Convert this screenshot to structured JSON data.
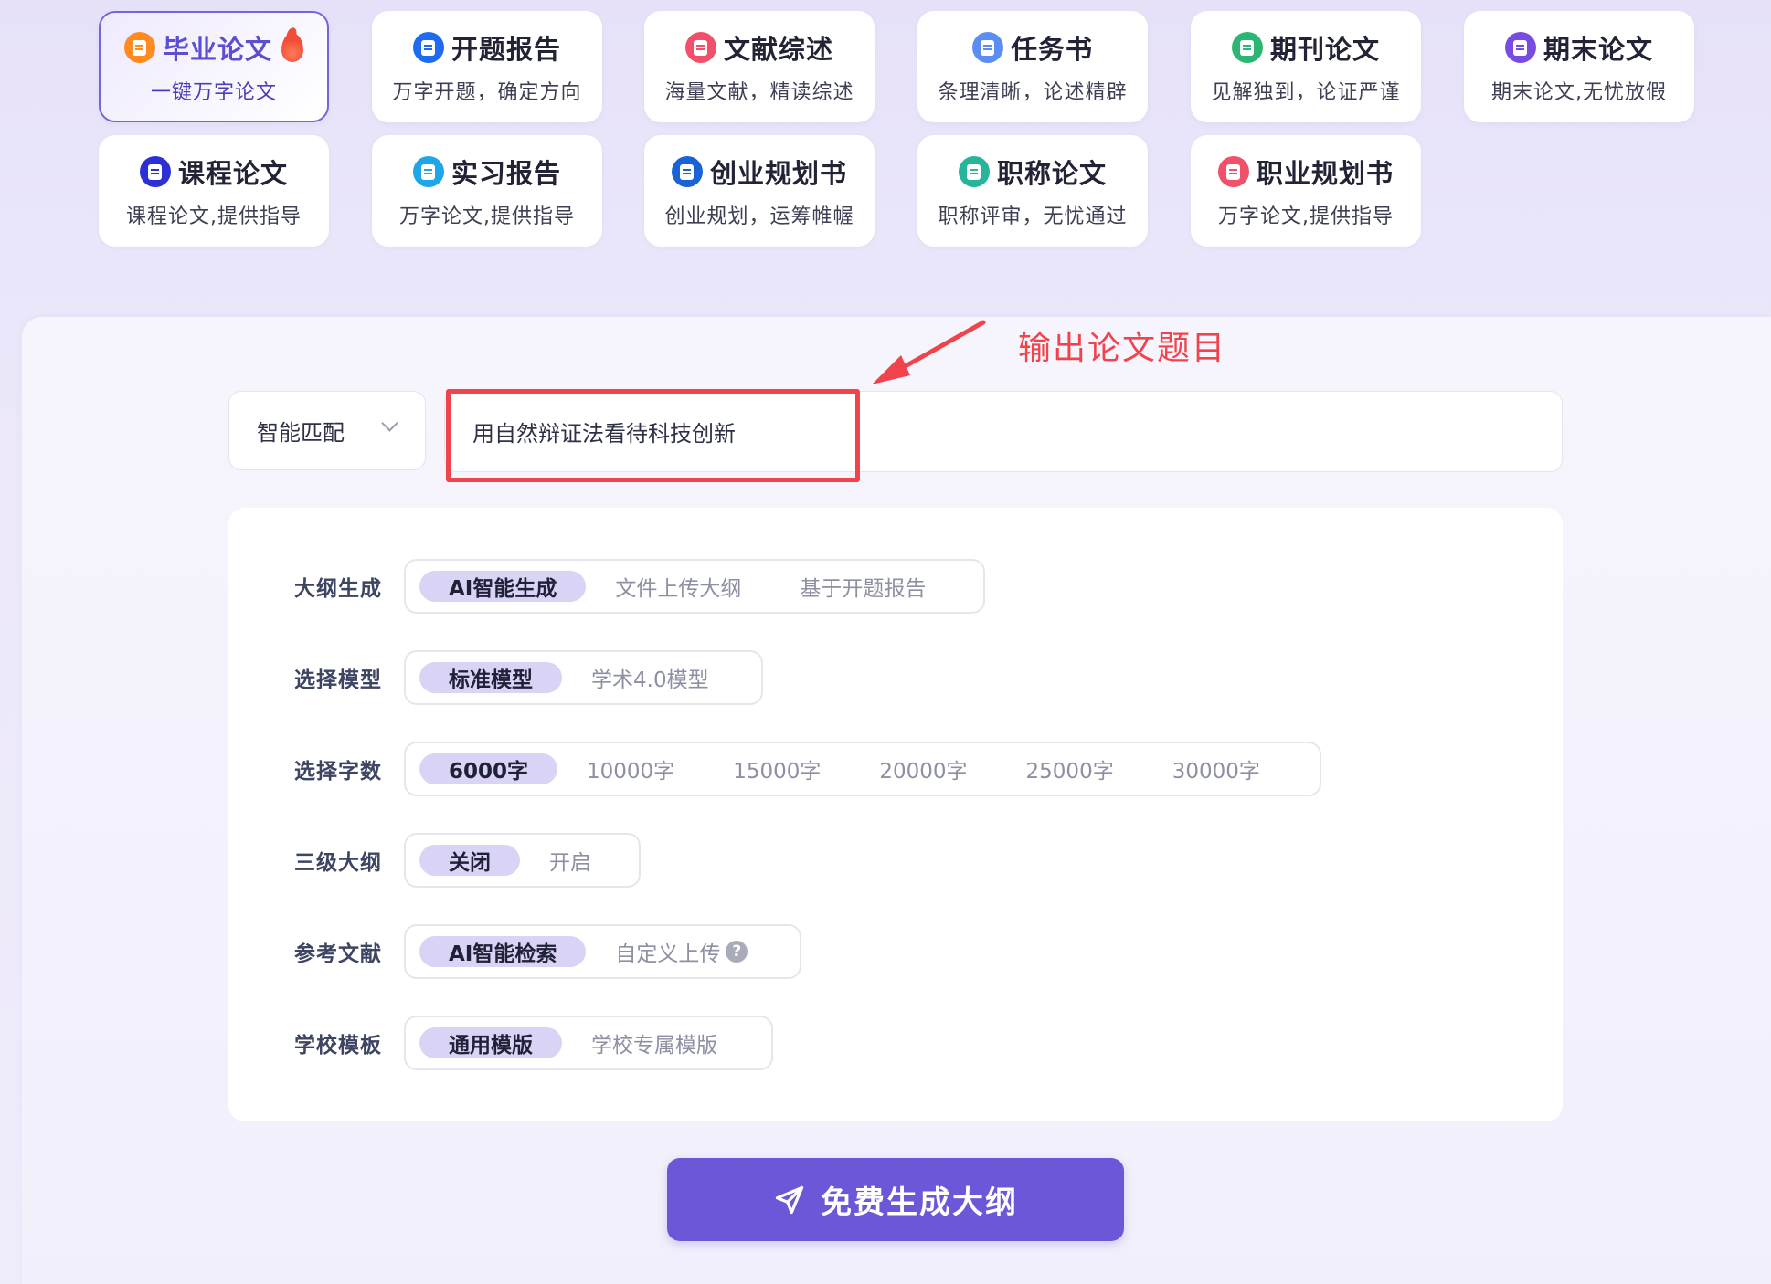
{
  "categories": [
    {
      "title": "毕业论文",
      "sub": "一键万字论文",
      "icon": "document-icon",
      "color": "#ff8a1f",
      "active": true,
      "hot": true
    },
    {
      "title": "开题报告",
      "sub": "万字开题，确定方向",
      "icon": "save-icon",
      "color": "#1f6bf0"
    },
    {
      "title": "文献综述",
      "sub": "海量文献，精读综述",
      "icon": "layers-icon",
      "color": "#f0506a"
    },
    {
      "title": "任务书",
      "sub": "条理清晰，论述精辟",
      "icon": "checklist-icon",
      "color": "#5b8ef5"
    },
    {
      "title": "期刊论文",
      "sub": "见解独到，论证严谨",
      "icon": "journal-icon",
      "color": "#2bb673"
    },
    {
      "title": "期末论文",
      "sub": "期末论文,无忧放假",
      "icon": "exam-icon",
      "color": "#7a4be0"
    },
    {
      "title": "课程论文",
      "sub": "课程论文,提供指导",
      "icon": "course-icon",
      "color": "#2a2fd6"
    },
    {
      "title": "实习报告",
      "sub": "万字论文,提供指导",
      "icon": "report-icon",
      "color": "#1da6e8"
    },
    {
      "title": "创业规划书",
      "sub": "创业规划，运筹帷幄",
      "icon": "plan-icon",
      "color": "#1a63d6"
    },
    {
      "title": "职称论文",
      "sub": "职称评审，无忧通过",
      "icon": "title-icon",
      "color": "#26b59a"
    },
    {
      "title": "职业规划书",
      "sub": "万字论文,提供指导",
      "icon": "career-icon",
      "color": "#f0506a"
    }
  ],
  "mode_select": {
    "value": "智能匹配"
  },
  "topic_input": {
    "value": "用自然辩证法看待科技创新"
  },
  "annotation": {
    "text": "输出论文题目"
  },
  "options": [
    {
      "label": "大纲生成",
      "choices": [
        "AI智能生成",
        "文件上传大纲",
        "基于开题报告"
      ],
      "selected": 0
    },
    {
      "label": "选择模型",
      "choices": [
        "标准模型",
        "学术4.0模型"
      ],
      "selected": 0
    },
    {
      "label": "选择字数",
      "choices": [
        "6000字",
        "10000字",
        "15000字",
        "20000字",
        "25000字",
        "30000字"
      ],
      "selected": 0
    },
    {
      "label": "三级大纲",
      "choices": [
        "关闭",
        "开启"
      ],
      "selected": 0
    },
    {
      "label": "参考文献",
      "choices": [
        "AI智能检索",
        "自定义上传"
      ],
      "selected": 0,
      "help_after": 1
    },
    {
      "label": "学校模板",
      "choices": [
        "通用模版",
        "学校专属模版"
      ],
      "selected": 0
    }
  ],
  "help_icon": "?",
  "generate_button": {
    "label": "免费生成大纲",
    "icon": "send-icon"
  }
}
